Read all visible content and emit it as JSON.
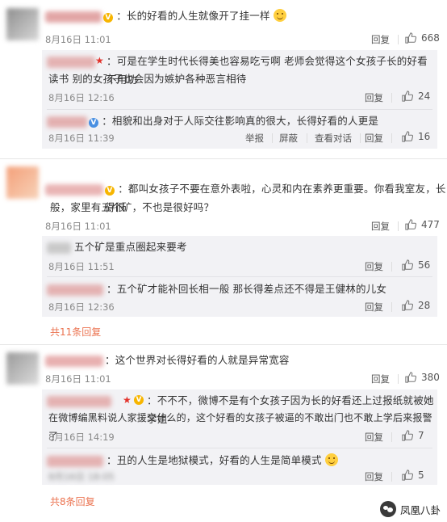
{
  "actions": {
    "reply": "回复",
    "report": "举报",
    "block": "屏蔽",
    "view_dialog": "查看对话"
  },
  "comments": [
    {
      "text": "：长的好看的人生就像开了挂一样",
      "time": "8月16日 11:01",
      "likes": "668",
      "replies": [
        {
          "text_line1": "：可是在学生时代长得美也容易吃亏啊 老师会觉得这个女孩子长的好看不用功",
          "text_line2": "读书 别的女孩子也会因为嫉妒各种恶言相待",
          "time": "8月16日 12:16",
          "likes": "24"
        },
        {
          "text_line1": "：相貌和出身对于人际交往影响真的很大，长得好看的人更是",
          "time": "8月16日 11:39",
          "likes": "16"
        }
      ]
    },
    {
      "text_line1": "：都叫女孩子不要在意外表啦，心灵和内在素养更重要。你看我室友，长得很",
      "text_line2": "般，家里有五个矿，不也是很好吗？",
      "time": "8月16日 11:01",
      "likes": "477",
      "replies": [
        {
          "text_line1": "五个矿是重点圈起来要考",
          "time": "8月16日 11:51",
          "likes": "56"
        },
        {
          "text_line1": "：五个矿才能补回长相一般 那长得差点还不得是王健林的儿女",
          "time": "8月16日 12:36",
          "likes": "28"
        }
      ],
      "more": "共11条回复"
    },
    {
      "text": "：这个世界对长得好看的人就是异常宽容",
      "time": "8月16日 11:01",
      "likes": "380",
      "replies": [
        {
          "text_line1": "：不不不，微博不是有个女孩子因为长的好看还上过报纸就被她学姐",
          "text_line2": "在微博编黑料说人家援交什么的，这个好看的女孩子被逼的不敢出门也不敢上学后来报警了",
          "time": "8月16日 14:19",
          "likes": "7"
        },
        {
          "text_line1": "：丑的人生是地狱模式，好看的人生是简单模式",
          "time": "8月16日 18:05",
          "likes": "5"
        }
      ],
      "more": "共8条回复"
    }
  ],
  "watermark": {
    "label": "凤凰八卦"
  }
}
